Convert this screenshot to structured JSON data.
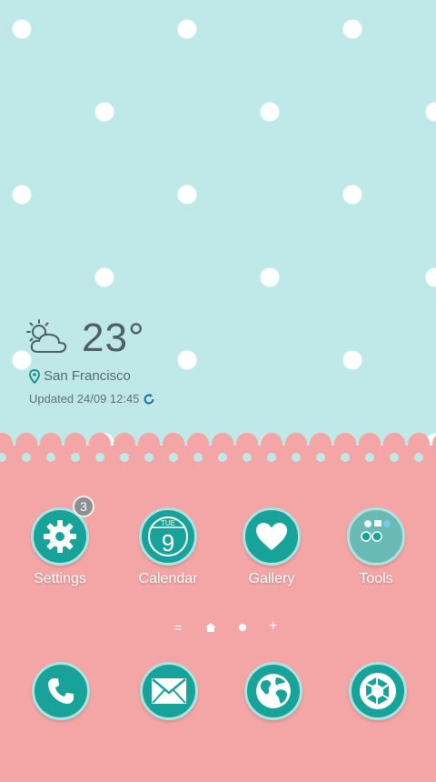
{
  "weather": {
    "temperature": "23°",
    "location": "San Francisco",
    "updated": "Updated 24/09 12:45",
    "icon": "partly-cloudy-icon"
  },
  "apps": [
    {
      "label": "Settings",
      "icon": "gear-icon",
      "badge": "3"
    },
    {
      "label": "Calendar",
      "icon": "calendar-icon",
      "day_label": "TUE",
      "date": "9"
    },
    {
      "label": "Gallery",
      "icon": "heart-icon"
    },
    {
      "label": "Tools",
      "icon": "tools-folder-icon"
    }
  ],
  "dock": [
    {
      "icon": "phone-icon"
    },
    {
      "icon": "mail-icon"
    },
    {
      "icon": "globe-icon"
    },
    {
      "icon": "camera-shutter-icon"
    }
  ],
  "page_indicator": {
    "items": [
      "=",
      "home",
      "dot",
      "+"
    ],
    "active_index": 1
  },
  "colors": {
    "sky": "#bfe9e8",
    "pink": "#f4a6a6",
    "teal": "#17a39a"
  }
}
